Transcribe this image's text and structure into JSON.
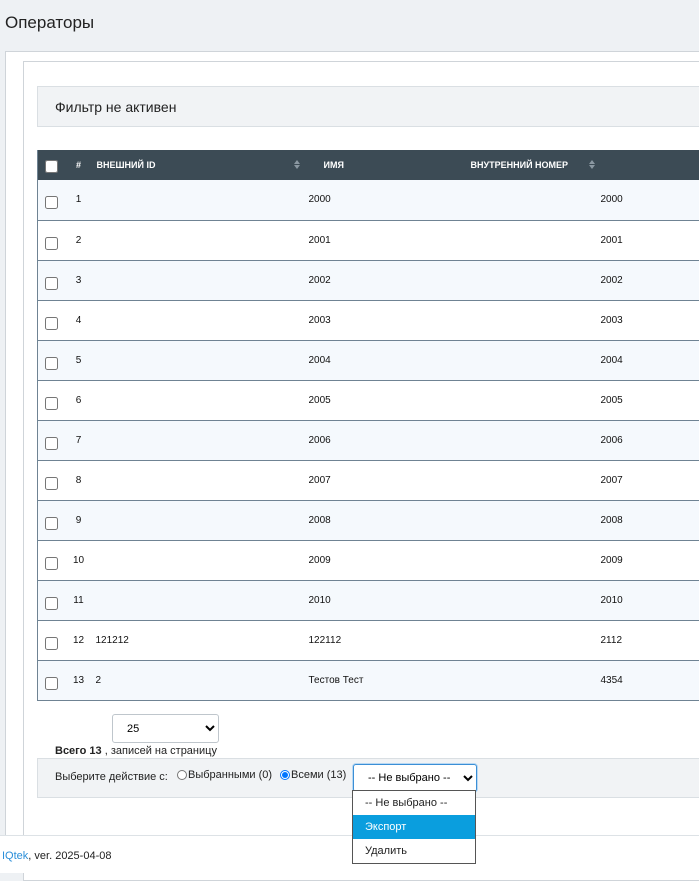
{
  "page": {
    "title": "Операторы"
  },
  "filter": {
    "status_text": "Фильтр не активен"
  },
  "table": {
    "columns": {
      "num": "#",
      "external_id": "ВНЕШНИЙ ID",
      "name": "ИМЯ",
      "internal_number": "ВНУТРЕННИЙ НОМЕР"
    },
    "rows": [
      {
        "num": "1",
        "external_id": "",
        "name": "2000",
        "internal_number": "2000"
      },
      {
        "num": "2",
        "external_id": "",
        "name": "2001",
        "internal_number": "2001"
      },
      {
        "num": "3",
        "external_id": "",
        "name": "2002",
        "internal_number": "2002"
      },
      {
        "num": "4",
        "external_id": "",
        "name": "2003",
        "internal_number": "2003"
      },
      {
        "num": "5",
        "external_id": "",
        "name": "2004",
        "internal_number": "2004"
      },
      {
        "num": "6",
        "external_id": "",
        "name": "2005",
        "internal_number": "2005"
      },
      {
        "num": "7",
        "external_id": "",
        "name": "2006",
        "internal_number": "2006"
      },
      {
        "num": "8",
        "external_id": "",
        "name": "2007",
        "internal_number": "2007"
      },
      {
        "num": "9",
        "external_id": "",
        "name": "2008",
        "internal_number": "2008"
      },
      {
        "num": "10",
        "external_id": "",
        "name": "2009",
        "internal_number": "2009"
      },
      {
        "num": "11",
        "external_id": "",
        "name": "2010",
        "internal_number": "2010"
      },
      {
        "num": "12",
        "external_id": "121212",
        "name": "122112",
        "internal_number": "2112"
      },
      {
        "num": "13",
        "external_id": "2",
        "name": "Тестов Тест",
        "internal_number": "4354"
      }
    ]
  },
  "pagination": {
    "per_page_value": "25",
    "total_prefix": "Всего ",
    "total_count": "13",
    "total_suffix": " , записей на страницу"
  },
  "actions": {
    "label": "Выберите действие с:",
    "selected_label": "Выбранными (0)",
    "all_label": "Всеми (13)",
    "select_value": "-- Не выбрано --",
    "options": [
      "-- Не выбрано --",
      "Экспорт",
      "Удалить"
    ],
    "highlighted_option_index": 1
  },
  "footer": {
    "brand": "IQtek",
    "version": ", ver. 2025-04-08"
  },
  "colors": {
    "header_bg": "#3c4b55",
    "accent": "#0a9ede",
    "link": "#2a8ed9"
  }
}
